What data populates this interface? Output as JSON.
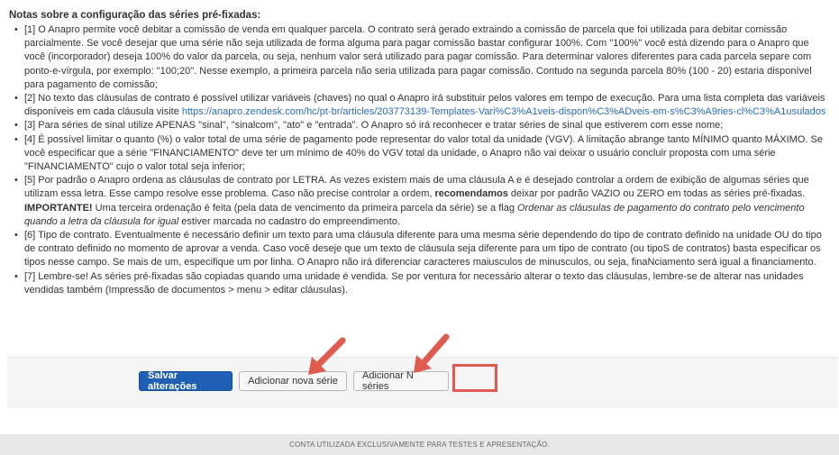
{
  "notes": {
    "title": "Notas sobre a configuração das séries pré-fixadas:",
    "items": [
      {
        "text": "[1] O Anapro permite você debitar a comissão de venda em qualquer parcela. O contrato será gerado extraindo a comissão de parcela que foi utilizada para debitar comissão parcialmente. Se você desejar que uma série não seja utilizada de forma alguma para pagar comissão bastar configurar 100%. Com \"100%\" você está dizendo para o Anapro que você (incorporador) deseja 100% do valor da parcela, ou seja, nenhum valor será utilizado para pagar comissão. Para determinar valores diferentes para cada parcela separe com ponto-e-vírgula, por exemplo: \"100;20\". Nesse exemplo, a primeira parcela não seria utilizada para pagar comissão. Contudo na segunda parcela 80% (100 - 20) estaria disponível para pagamento de comissão;"
      },
      {
        "text_before": "[2] No texto das cláusulas de contrato é possível utilizar variáveis (chaves) no qual o Anapro irá substituir pelos valores em tempo de execução. Para uma lista completa das variáveis disponíveis em cada cláusula visite ",
        "link": "https://anapro.zendesk.com/hc/pt-br/articles/203773139-Templates-Vari%C3%A1veis-dispon%C3%ADveis-em-s%C3%A9ries-cl%C3%A1usulados"
      },
      {
        "text": "[3] Para séries de sinal utilize APENAS \"sinal\", \"sinalcom\", \"ato\" e \"entrada\". O Anapro só irá reconhecer e tratar séries de sinal que estiverem com esse nome;"
      },
      {
        "text": "[4] É possível limitar o quanto (%) o valor total de uma série de pagamento pode representar do valor total da unidade (VGV). A limitação abrange tanto MÍNIMO quanto MÁXIMO. Se você especificar que a série \"FINANCIAMENTO\" deve ter um mínimo de 40% do VGV total da unidade, o Anapro não vai deixar o usuário concluir proposta com uma série \"FINANCIAMENTO\" cujo o valor total seja inferior;"
      },
      {
        "part1": "[5] Por padrão o Anapro ordena as cláusulas de contrato por LETRA. As vezes existem mais de uma cláusula A e é desejado controlar a ordem de exibição de algumas séries que utilizam essa letra. Esse campo resolve esse problema. Caso não precise controlar a ordem, ",
        "bold1": "recomendamos",
        "part2": " deixar por padrão VAZIO ou ZERO em todas as séries pré-fixadas. ",
        "bold2": "IMPORTANTE!",
        "part3": " Uma terceira ordenação é feita (pela data de vencimento da primeira parcela da série) se a flag ",
        "italic": "Ordenar as cláusulas de pagamento do contrato pelo vencimento quando a letra da cláusula for igual",
        "part4": " estiver marcada no cadastro do empreendimento."
      },
      {
        "text": "[6] Tipo de contrato. Eventualmente é necessário definir um texto para uma cláusula diferente para uma mesma série dependendo do tipo de contrato definido na unidade OU do tipo de contrato definido no momento de aprovar a venda. Caso você deseje que um texto de cláusula seja diferente para um tipo de contrato (ou tipoS de contratos) basta especificar os tipos nesse campo. Se mais de um, especifique um por linha. O Anapro não irá diferenciar caracteres maiusculos de minusculos, ou seja, finaNciamento será igual a financiamento."
      },
      {
        "text": "[7] Lembre-se! As séries pré-fixadas são copiadas quando uma unidade é vendida. Se por ventura for necessário alterar o texto das cláusulas, lembre-se de alterar nas unidades vendidas também (Impressão de documentos > menu > editar cláusulas)."
      }
    ]
  },
  "actions": {
    "save_label": "Salvar alterações",
    "add_one_label": "Adicionar nova série",
    "add_n_label": "Adicionar N séries"
  },
  "annotations": {
    "arrow_color": "#e05b4f",
    "highlight_color": "#e05b4f"
  },
  "footer": {
    "text": "CONTA UTILIZADA EXCLUSIVAMENTE PARA TESTES E APRESENTAÇÃO."
  },
  "colors": {
    "primary": "#1f5fb4",
    "link": "#2a6ebb"
  }
}
